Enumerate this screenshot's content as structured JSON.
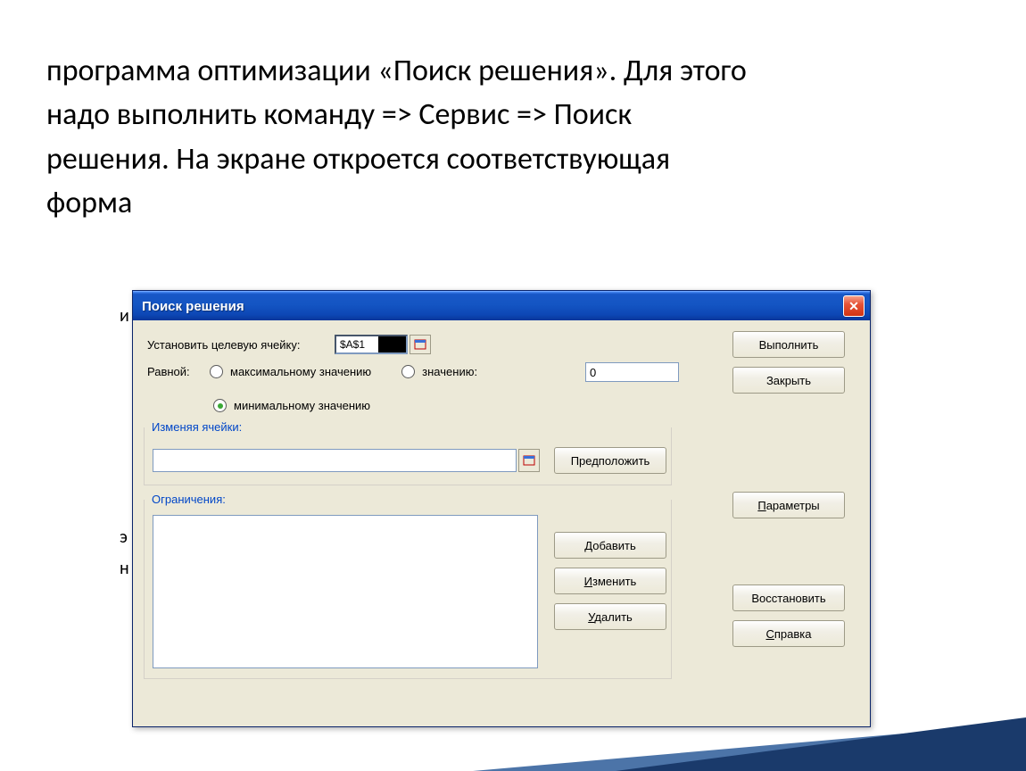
{
  "slide_text": "   программа оптимизации «Поиск решения». Для этого надо выполнить команду => Сервис => Поиск решения. На экране откроется соответствующая форма",
  "dialog": {
    "title": "Поиск решения",
    "target_label": "Установить целевую ячейку:",
    "target_value": "$A$1",
    "equal_label": "Равной:",
    "radio_max": "максимальному значению",
    "radio_min": "минимальному значению",
    "radio_val": "значению:",
    "value_input": "0",
    "changing_title": "Изменяя ячейки:",
    "constraints_title": "Ограничения:",
    "buttons": {
      "execute": "Выполнить",
      "close": "Закрыть",
      "suggest": "Предположить",
      "params": "Параметры",
      "add": "Добавить",
      "edit": "Изменить",
      "delete": "Удалить",
      "reset": "Восстановить",
      "help": "Справка"
    }
  },
  "side_chars": {
    "i": "и",
    "e": "э",
    "n": "н"
  }
}
